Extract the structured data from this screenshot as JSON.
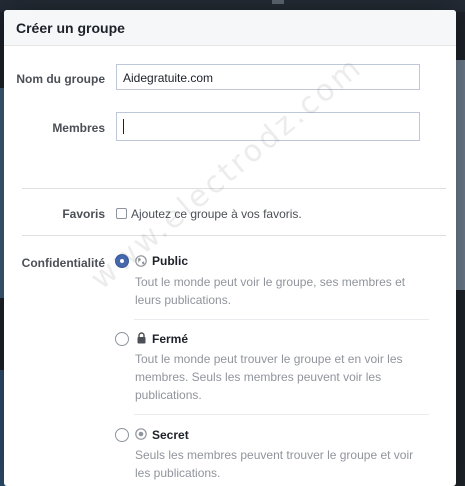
{
  "dialog": {
    "title": "Créer un groupe",
    "name_label": "Nom du groupe",
    "name_value": "Aidegratuite.com",
    "members_label": "Membres",
    "members_value": "",
    "favorites_label": "Favoris",
    "favorites_text": "Ajoutez ce groupe à vos favoris.",
    "favorites_checked": false,
    "privacy_label": "Confidentialité",
    "privacy_options": [
      {
        "title": "Public",
        "icon": "globe-icon",
        "selected": true,
        "description": "Tout le monde peut voir le groupe, ses membres et leurs publications."
      },
      {
        "title": "Fermé",
        "icon": "lock-icon",
        "selected": false,
        "description": "Tout le monde peut trouver le groupe et en voir les membres. Seuls les membres peuvent voir les publications."
      },
      {
        "title": "Secret",
        "icon": "secret-icon",
        "selected": false,
        "description": "Seuls les membres peuvent trouver le groupe et voir les publications."
      }
    ]
  },
  "watermark": "www.electrodz.com",
  "colors": {
    "accent": "#4267b2",
    "header_bg": "#f6f7f9",
    "overlay": "#1d2129"
  }
}
